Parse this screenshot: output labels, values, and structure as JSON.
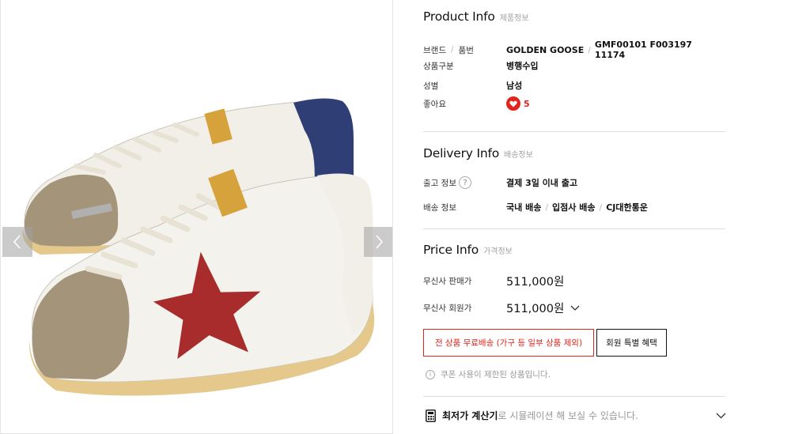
{
  "product_info": {
    "title_en": "Product Info",
    "title_ko": "제품정보",
    "brand_label": "브랜드",
    "code_label": "품번",
    "brand": "GOLDEN GOOSE",
    "code": "GMF00101 F003197 11174",
    "category_label": "상품구분",
    "category_value": "병행수입",
    "gender_label": "성별",
    "gender_value": "남성",
    "likes_label": "좋아요",
    "likes_count": "5"
  },
  "delivery_info": {
    "title_en": "Delivery Info",
    "title_ko": "배송정보",
    "release_label": "출고 정보",
    "release_help": "?",
    "release_value": "결제 3일 이내 출고",
    "shipping_label": "배송 정보",
    "shipping_parts": [
      "국내 배송",
      "입점사 배송",
      "CJ대한통운"
    ]
  },
  "price_info": {
    "title_en": "Price Info",
    "title_ko": "가격정보",
    "sale_label": "무신사 판매가",
    "sale_price": "511,000원",
    "member_label": "무신사 회원가",
    "member_price": "511,000원"
  },
  "buttons": {
    "free_shipping": "전 상품 무료배송 (가구 등 일부 상품 제외)",
    "member_benefit": "회원 특별 혜택"
  },
  "coupon_note": "쿠폰 사용이 제한된 상품입니다.",
  "calculator": {
    "strong": "최저가 계산기",
    "rest": "로 시뮬레이션 해 보실 수 있습니다."
  },
  "colors": {
    "accent_red": "#e1251b",
    "divider": "#dcdcdc"
  },
  "icons": {
    "prev": "chevron-left-icon",
    "next": "chevron-right-icon",
    "heart": "heart-icon",
    "help": "help-icon",
    "dropdown": "chevron-down-icon",
    "info": "info-icon",
    "calculator": "calculator-icon"
  }
}
